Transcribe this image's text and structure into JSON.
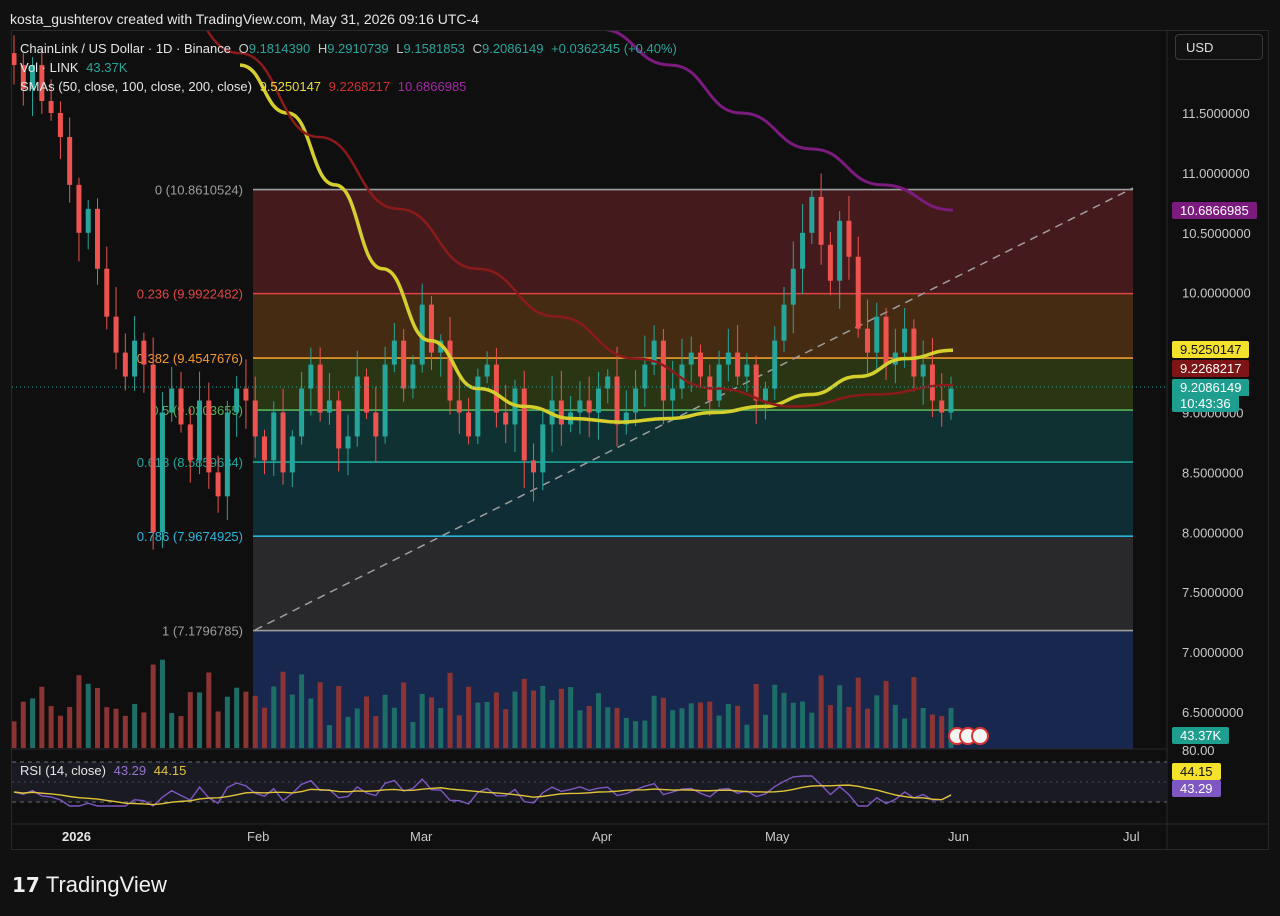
{
  "header": {
    "author_line": "kosta_gushterov created with TradingView.com, May 31, 2026 09:16 UTC-4"
  },
  "legend": {
    "symbol": "ChainLink / US Dollar · 1D · Binance",
    "o_label": "O",
    "o": "9.1814390",
    "h_label": "H",
    "h": "9.2910739",
    "l_label": "L",
    "l": "9.1581853",
    "c_label": "C",
    "c": "9.2086149",
    "change": "+0.0362345 (+0.40%)",
    "vol_label": "Vol · LINK",
    "vol": "43.37K",
    "sma_label": "SMAs (50, close, 100, close, 200, close)",
    "sma50": "9.5250147",
    "sma100": "9.2268217",
    "sma200": "10.6866985",
    "rsi_label": "RSI (14, close)",
    "rsi": "43.29",
    "rsi_ma": "44.15"
  },
  "currency_button": "USD",
  "badges": {
    "sma200": "10.6866985",
    "sma50": "9.5250147",
    "sma100": "9.2268217",
    "price": "9.2086149",
    "countdown": "10:43:36",
    "volume": "43.37K",
    "rsi_ma": "44.15",
    "rsi": "43.29"
  },
  "colors": {
    "up": "#26a69a",
    "down": "#ef5350",
    "sma50": "#d4cf2c",
    "sma100": "#8b1a1a",
    "sma200": "#7b1b7e",
    "rsi": "#7e57c2",
    "rsi_ma": "#e0c43a"
  },
  "brand": {
    "logo_glyph": "17",
    "name": "TradingView"
  },
  "chart_data": {
    "type": "candlestick",
    "title": "ChainLink / US Dollar · 1D · Binance",
    "y_ticks": [
      "11.5000000",
      "11.0000000",
      "10.5000000",
      "10.0000000",
      "9.5000000",
      "9.0000000",
      "8.5000000",
      "8.0000000",
      "7.5000000",
      "7.0000000",
      "6.5000000"
    ],
    "x_ticks": [
      "2026",
      "Feb",
      "Mar",
      "Apr",
      "May",
      "Jun",
      "Jul"
    ],
    "ylim": [
      6.2,
      11.8
    ],
    "fibonacci": [
      {
        "level": "0",
        "price": 10.8610524,
        "label": "0 (10.8610524)",
        "color": "#9e9e9e",
        "fill": "#4a1c1f"
      },
      {
        "level": "0.236",
        "price": 9.9922482,
        "label": "0.236 (9.9922482)",
        "color": "#e04545",
        "fill": "#4a2f12"
      },
      {
        "level": "0.382",
        "price": 9.4547676,
        "label": "0.382 (9.4547676)",
        "color": "#f29b2a",
        "fill": "#2d3a14"
      },
      {
        "level": "0.5",
        "price": 9.0203655,
        "label": "0.5 (9.0203655)",
        "color": "#57b15a",
        "fill": "#0f3535"
      },
      {
        "level": "0.618",
        "price": 8.5859634,
        "label": "0.618 (8.5859634)",
        "color": "#19a89a",
        "fill": "#103138"
      },
      {
        "level": "0.786",
        "price": 7.9674925,
        "label": "0.786 (7.9674925)",
        "color": "#28b6d8",
        "fill": "#2c2c2f"
      },
      {
        "level": "1",
        "price": 7.1796785,
        "label": "1 (7.1796785)",
        "color": "#9e9e9e",
        "fill": "#1a2a55"
      }
    ],
    "series": [
      {
        "name": "LINK",
        "kind": "close",
        "values": [
          11.9,
          11.7,
          11.9,
          11.6,
          11.5,
          11.3,
          10.9,
          10.5,
          10.7,
          10.2,
          9.8,
          9.5,
          9.3,
          9.6,
          9.4,
          8.0,
          9.0,
          9.2,
          8.9,
          8.6,
          9.1,
          8.5,
          8.3,
          9.0,
          9.2,
          9.1,
          8.8,
          8.6,
          9.0,
          8.5,
          8.8,
          9.2,
          9.4,
          9.0,
          9.1,
          8.7,
          8.8,
          9.3,
          9.0,
          8.8,
          9.4,
          9.6,
          9.2,
          9.4,
          9.9,
          9.5,
          9.6,
          9.1,
          9.0,
          8.8,
          9.3,
          9.4,
          9.0,
          8.9,
          9.2,
          8.6,
          8.5,
          8.9,
          9.1,
          8.9,
          9.0,
          9.1,
          9.0,
          9.2,
          9.3,
          8.9,
          9.0,
          9.2,
          9.4,
          9.6,
          9.1,
          9.2,
          9.4,
          9.5,
          9.3,
          9.1,
          9.4,
          9.5,
          9.3,
          9.4,
          9.1,
          9.2,
          9.6,
          9.9,
          10.2,
          10.5,
          10.8,
          10.4,
          10.1,
          10.6,
          10.3,
          9.7,
          9.5,
          9.8,
          9.4,
          9.5,
          9.7,
          9.3,
          9.4,
          9.1,
          9.0,
          9.2
        ]
      },
      {
        "name": "SMA 50",
        "values": [
          11.9,
          11.5,
          10.9,
          10.2,
          9.6,
          9.2,
          9.05,
          8.95,
          8.92,
          8.95,
          9.0,
          9.05,
          9.15,
          9.3,
          9.45,
          9.52
        ]
      },
      {
        "name": "SMA 100",
        "values": [
          12.6,
          12.0,
          11.3,
          10.7,
          10.2,
          9.8,
          9.45,
          9.2,
          9.05,
          9.15,
          9.23
        ]
      },
      {
        "name": "SMA 200",
        "values": [
          12.2,
          11.9,
          11.5,
          11.2,
          10.9,
          10.69
        ]
      }
    ],
    "rsi": {
      "value": 43.29,
      "ma": 44.15,
      "upper": 70,
      "lower": 30,
      "range_label": "80.00"
    }
  }
}
